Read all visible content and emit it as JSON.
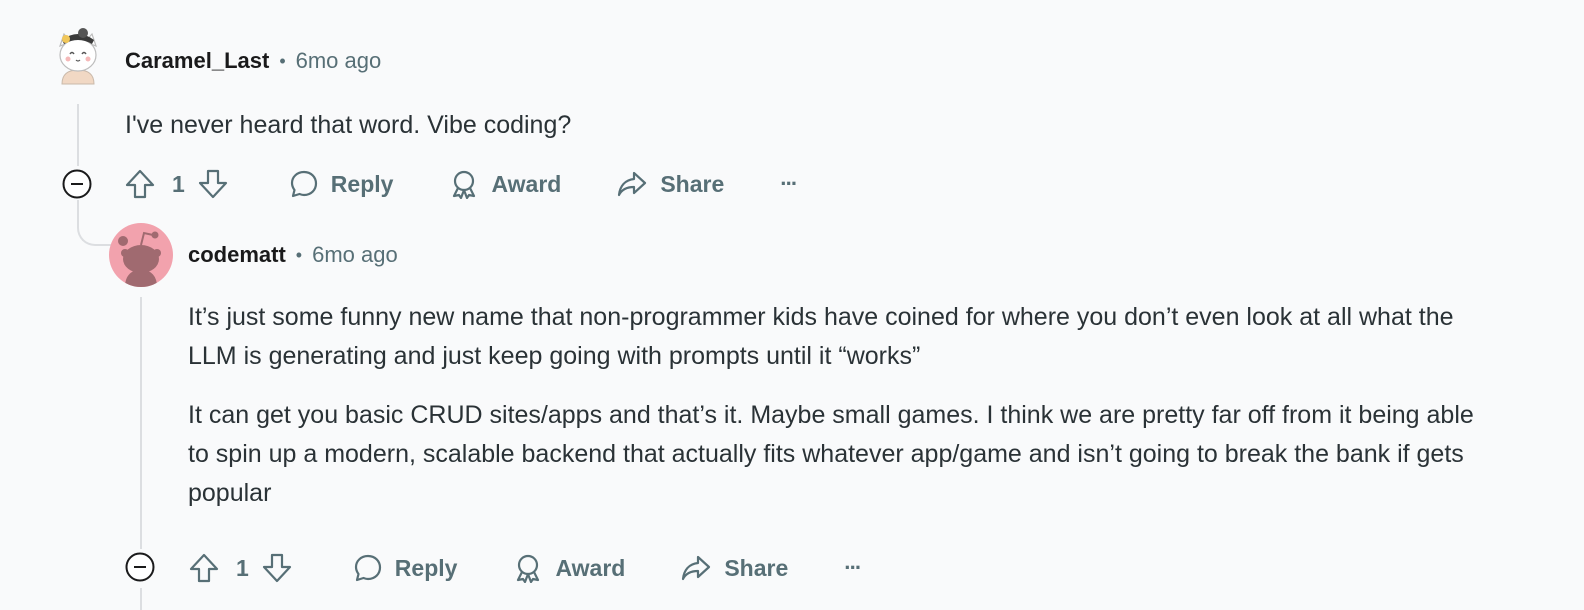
{
  "comments": [
    {
      "author": "Caramel_Last",
      "time": "6mo ago",
      "paragraphs": [
        "I've never heard that word. Vibe coding?"
      ],
      "score": "1",
      "actions": {
        "reply": "Reply",
        "award": "Award",
        "share": "Share",
        "more": "···"
      }
    },
    {
      "author": "codematt",
      "time": "6mo ago",
      "paragraphs": [
        "It’s just some funny new name that non-programmer kids have coined for where you don’t even look at all what the LLM is generating and just keep going with prompts until it “works”",
        "It can get you basic CRUD sites/apps and that’s it. Maybe small games. I think we are pretty far off from it being able to spin up a modern, scalable backend that actually fits whatever app/game and isn’t going to break the bank if gets popular"
      ],
      "score": "1",
      "actions": {
        "reply": "Reply",
        "award": "Award",
        "share": "Share",
        "more": "···"
      }
    }
  ],
  "meta_separator": "•",
  "colors": {
    "background": "#f9fafb",
    "meta": "#576f76",
    "thread_line": "#dcdee1",
    "avatar_pink": "#f2a2ad"
  },
  "icons": [
    "cat-avatar-icon",
    "snoo-avatar-icon",
    "collapse-icon",
    "upvote-icon",
    "downvote-icon",
    "reply-icon",
    "award-icon",
    "share-icon",
    "more-icon"
  ]
}
